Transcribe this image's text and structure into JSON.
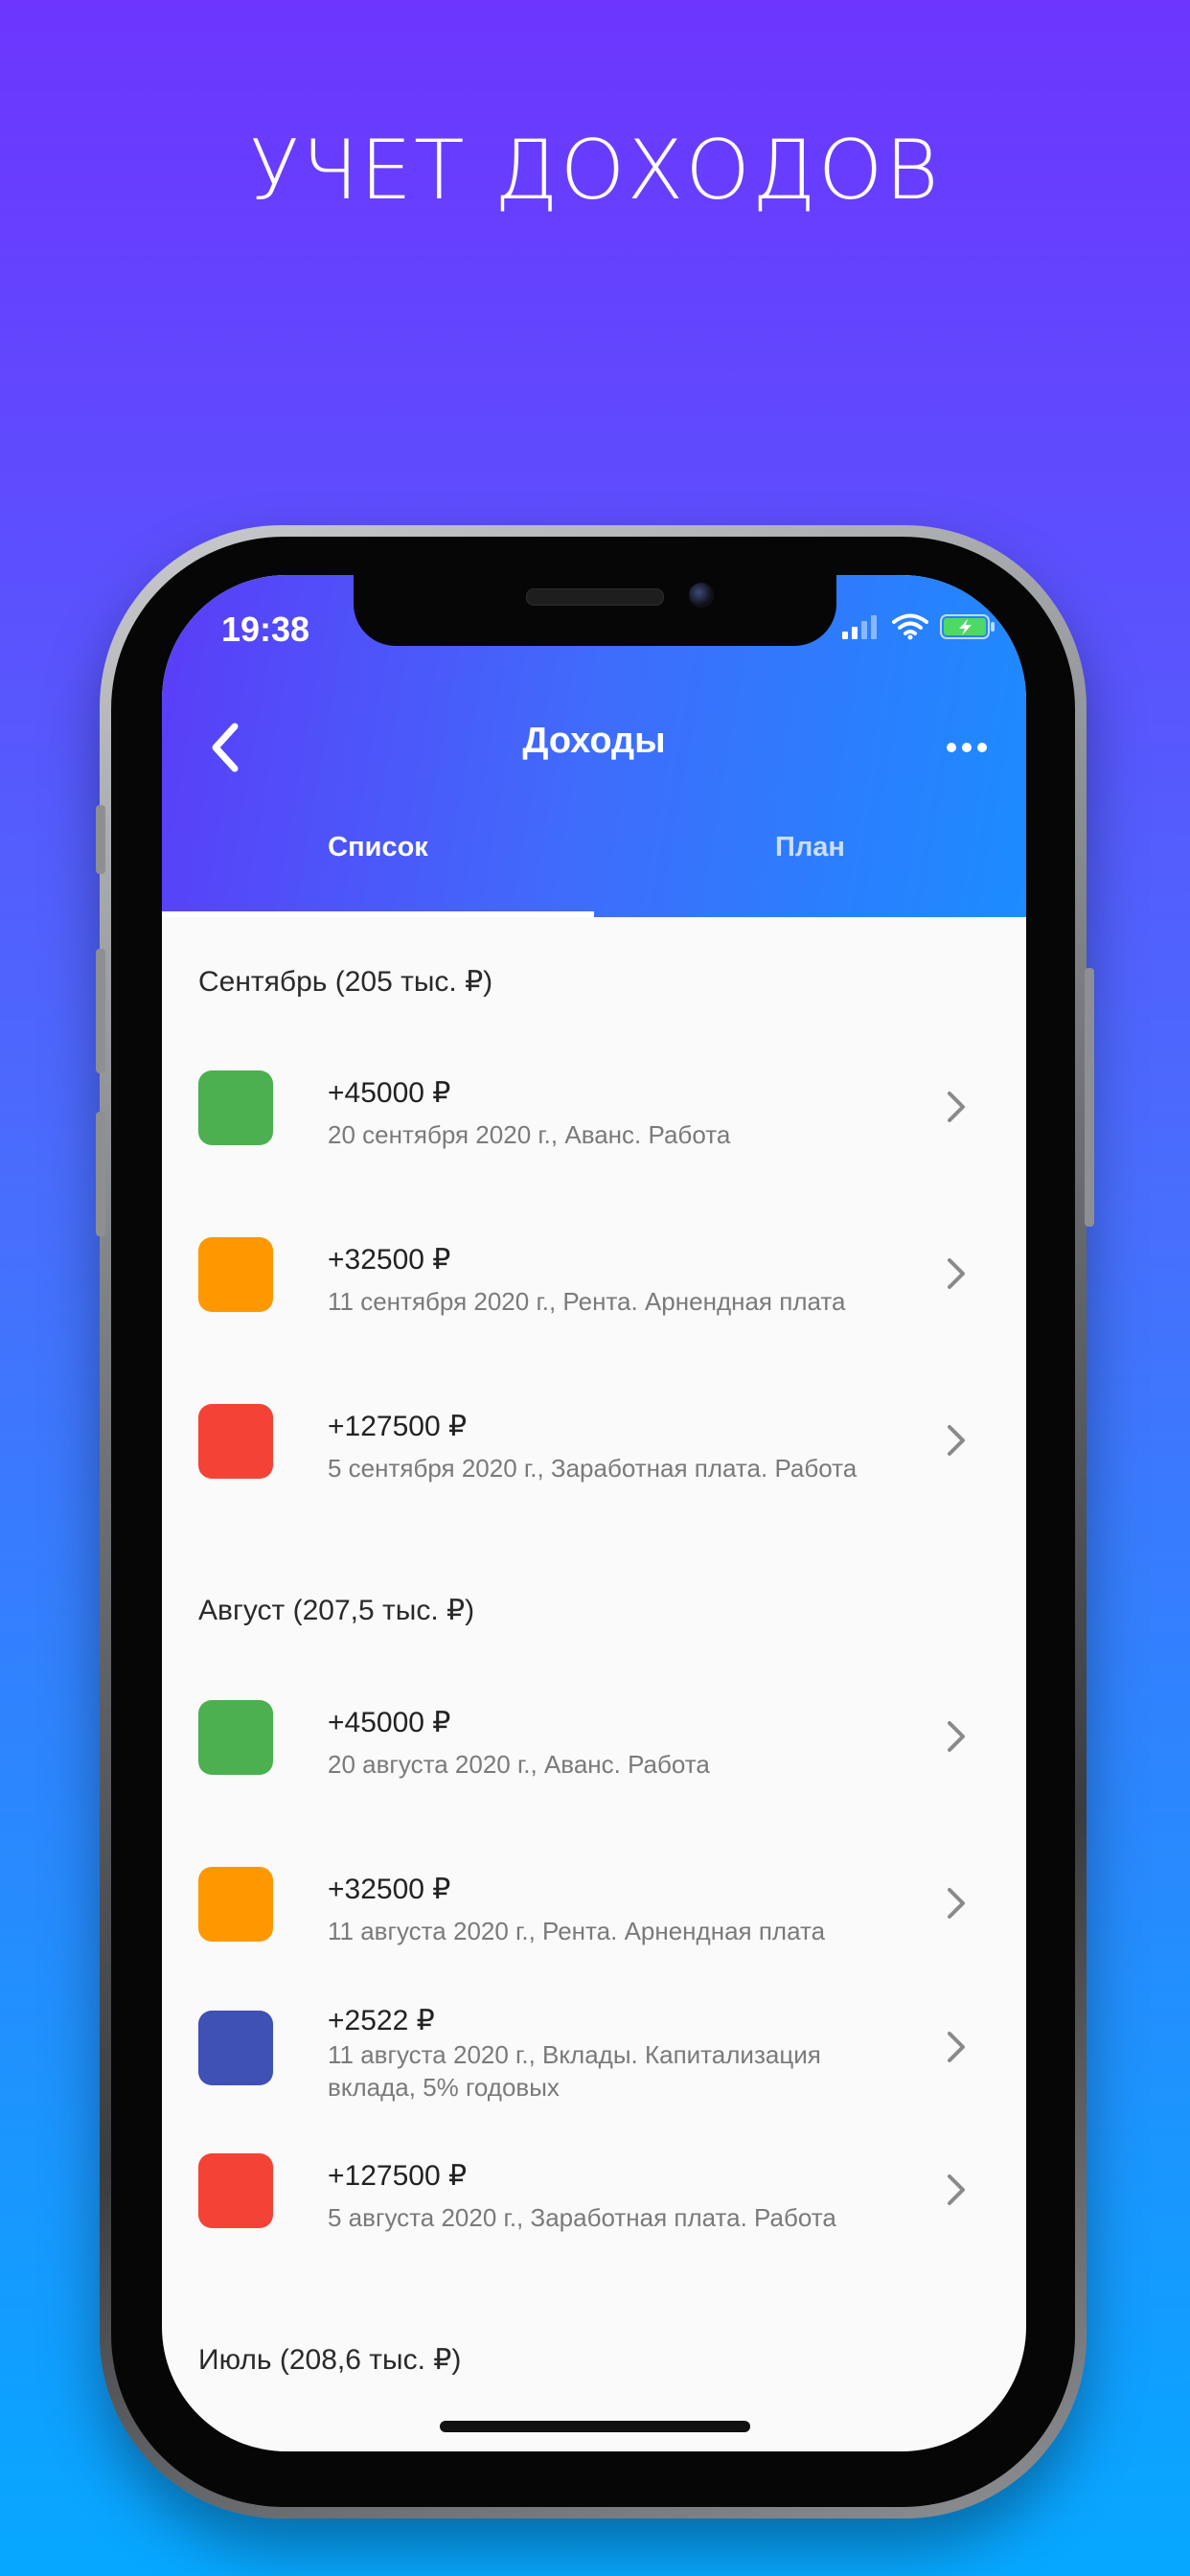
{
  "promo": {
    "title": "УЧЕТ ДОХОДОВ"
  },
  "status_bar": {
    "time": "19:38"
  },
  "nav": {
    "title": "Доходы"
  },
  "tabs": [
    {
      "label": "Список",
      "active": true
    },
    {
      "label": "План",
      "active": false
    }
  ],
  "sections": [
    {
      "header": "Сентябрь (205 тыс. ₽)",
      "items": [
        {
          "amount": "+45000 ₽",
          "desc": "20 сентября 2020 г., Аванс. Работа",
          "color": "#4caf50"
        },
        {
          "amount": "+32500 ₽",
          "desc": "11 сентября 2020 г., Рента. Арнендная плата",
          "color": "#ff9800"
        },
        {
          "amount": "+127500 ₽",
          "desc": "5 сентября 2020 г., Заработная плата. Работа",
          "color": "#f44336"
        }
      ]
    },
    {
      "header": "Август (207,5 тыс. ₽)",
      "items": [
        {
          "amount": "+45000 ₽",
          "desc": "20 августа 2020 г., Аванс. Работа",
          "color": "#4caf50"
        },
        {
          "amount": "+32500 ₽",
          "desc": "11 августа 2020 г., Рента. Арнендная плата",
          "color": "#ff9800"
        },
        {
          "amount": "+2522 ₽",
          "desc": "11 августа 2020 г., Вклады. Капитализация вклада, 5% годовых",
          "color": "#3f51b5"
        },
        {
          "amount": "+127500 ₽",
          "desc": "5 августа 2020 г., Заработная плата. Работа",
          "color": "#f44336"
        }
      ]
    },
    {
      "header": "Июль (208,6 тыс. ₽)",
      "items": []
    }
  ],
  "icons": {
    "back": "chevron-left-icon",
    "more": "more-horizontal-icon",
    "row_arrow": "chevron-right-icon",
    "signal": "cellular-signal-icon",
    "wifi": "wifi-icon",
    "battery": "battery-charging-icon"
  },
  "colors": {
    "header_start": "#5b3df8",
    "header_end": "#1c8cff",
    "battery_fill": "#4cd964"
  }
}
